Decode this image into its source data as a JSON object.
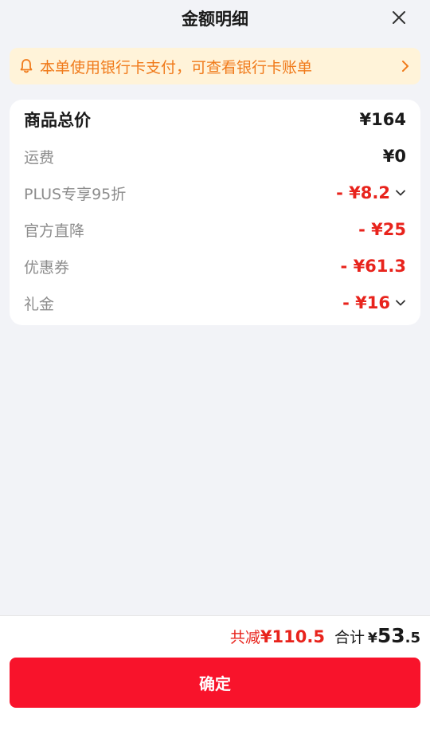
{
  "header": {
    "title": "金额明细",
    "close_icon": "close-icon"
  },
  "notice": {
    "icon": "bell-icon",
    "text": "本单使用银行卡支付，可查看银行卡账单",
    "arrow_icon": "chevron-right-icon",
    "color": "#f07a1a",
    "bg": "#fff3d9"
  },
  "breakdown": [
    {
      "label": "商品总价",
      "value": "¥164",
      "style": "total",
      "expandable": false
    },
    {
      "label": "运费",
      "value": "¥0",
      "style": "normal",
      "expandable": false
    },
    {
      "label": "PLUS专享95折",
      "value": "- ¥8.2",
      "style": "discount",
      "expandable": true
    },
    {
      "label": "官方直降",
      "value": "- ¥25",
      "style": "discount",
      "expandable": false
    },
    {
      "label": "优惠券",
      "value": "- ¥61.3",
      "style": "discount",
      "expandable": false
    },
    {
      "label": "礼金",
      "value": "- ¥16",
      "style": "discount",
      "expandable": true
    }
  ],
  "summary": {
    "saved_label": "共减",
    "saved_value": "¥110.5",
    "total_label": "合计",
    "total_currency": "¥",
    "total_integer": "53",
    "total_decimal": ".5"
  },
  "confirm_label": "确定",
  "colors": {
    "accent_red": "#e8231c",
    "button_red": "#f8132b",
    "page_bg": "#f2f3f7"
  }
}
